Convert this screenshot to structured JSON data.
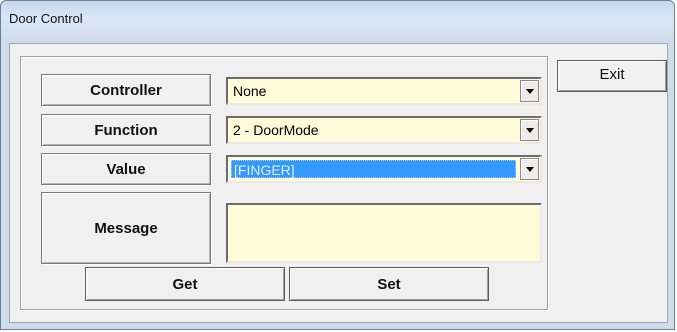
{
  "window": {
    "title": "Door Control"
  },
  "fields": [
    {
      "label": "Controller",
      "value": "None"
    },
    {
      "label": "Function",
      "value": "2 - DoorMode"
    },
    {
      "label": "Value",
      "value": "[FINGER]"
    },
    {
      "label": "Message",
      "value": ""
    }
  ],
  "buttons": {
    "get": "Get",
    "set": "Set",
    "exit": "Exit"
  },
  "colors": {
    "field_bg": "#fffbd8",
    "selection": "#3399ff"
  }
}
